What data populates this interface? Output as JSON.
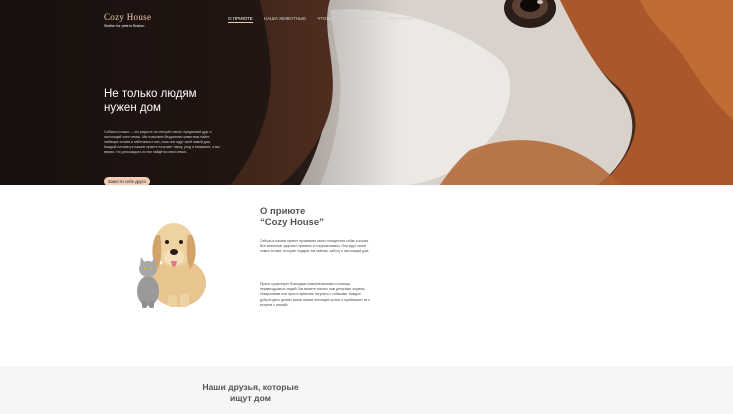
{
  "header": {
    "logo_title": "Cozy House",
    "logo_subtitle": "Shelter for pets in Boston",
    "nav": [
      {
        "label": "О ПРИЮТЕ",
        "active": true
      },
      {
        "label": "НАШИ ЖИВОТНЫЕ",
        "active": false
      },
      {
        "label": "ЧТОБЫ ПОМОЧЬ ПРИЮТУ",
        "active": false
      },
      {
        "label": "КОНТАКТЫ",
        "active": false
      }
    ]
  },
  "hero": {
    "title_line1": "Не только людям",
    "title_line2": "нужен дом",
    "text": "Собака и кошка — это радость на четырёх лапах, преданный друг и настоящий член семьи. Мы помогаем бездомным животным найти любящих хозяев и заботимся о них, пока они ждут свой новый дом. Каждый питомец в нашем приюте получает ласку, уход и внимание, а мы верим, что для каждого из них найдётся своя семья.",
    "button_label": "Завести себе друга"
  },
  "about": {
    "title_line1": "О приюте",
    "title_line2": "“Cozy House”",
    "paragraph1": "Сейчас в нашем приюте проживает около пятидесяти собак и кошек. Все животные здоровы, привиты и стерилизованы. Они ждут своих новых хозяев, которые подарят им любовь, заботу и настоящий дом.",
    "paragraph2": "Приют существует благодаря пожертвованиям и помощи неравнодушных людей. Вы можете помочь нам деньгами, кормом, лекарствами или просто приехать погулять с собаками. Каждое доброе дело делает жизнь наших питомцев лучше и приближает их к встрече с семьёй."
  },
  "friends": {
    "title_line1": "Наши друзья, которые",
    "title_line2": "ищут дом"
  },
  "colors": {
    "accent": "#f1cdb3",
    "hero_bg": "#2a1b16",
    "friends_bg": "#f6f6f6"
  }
}
